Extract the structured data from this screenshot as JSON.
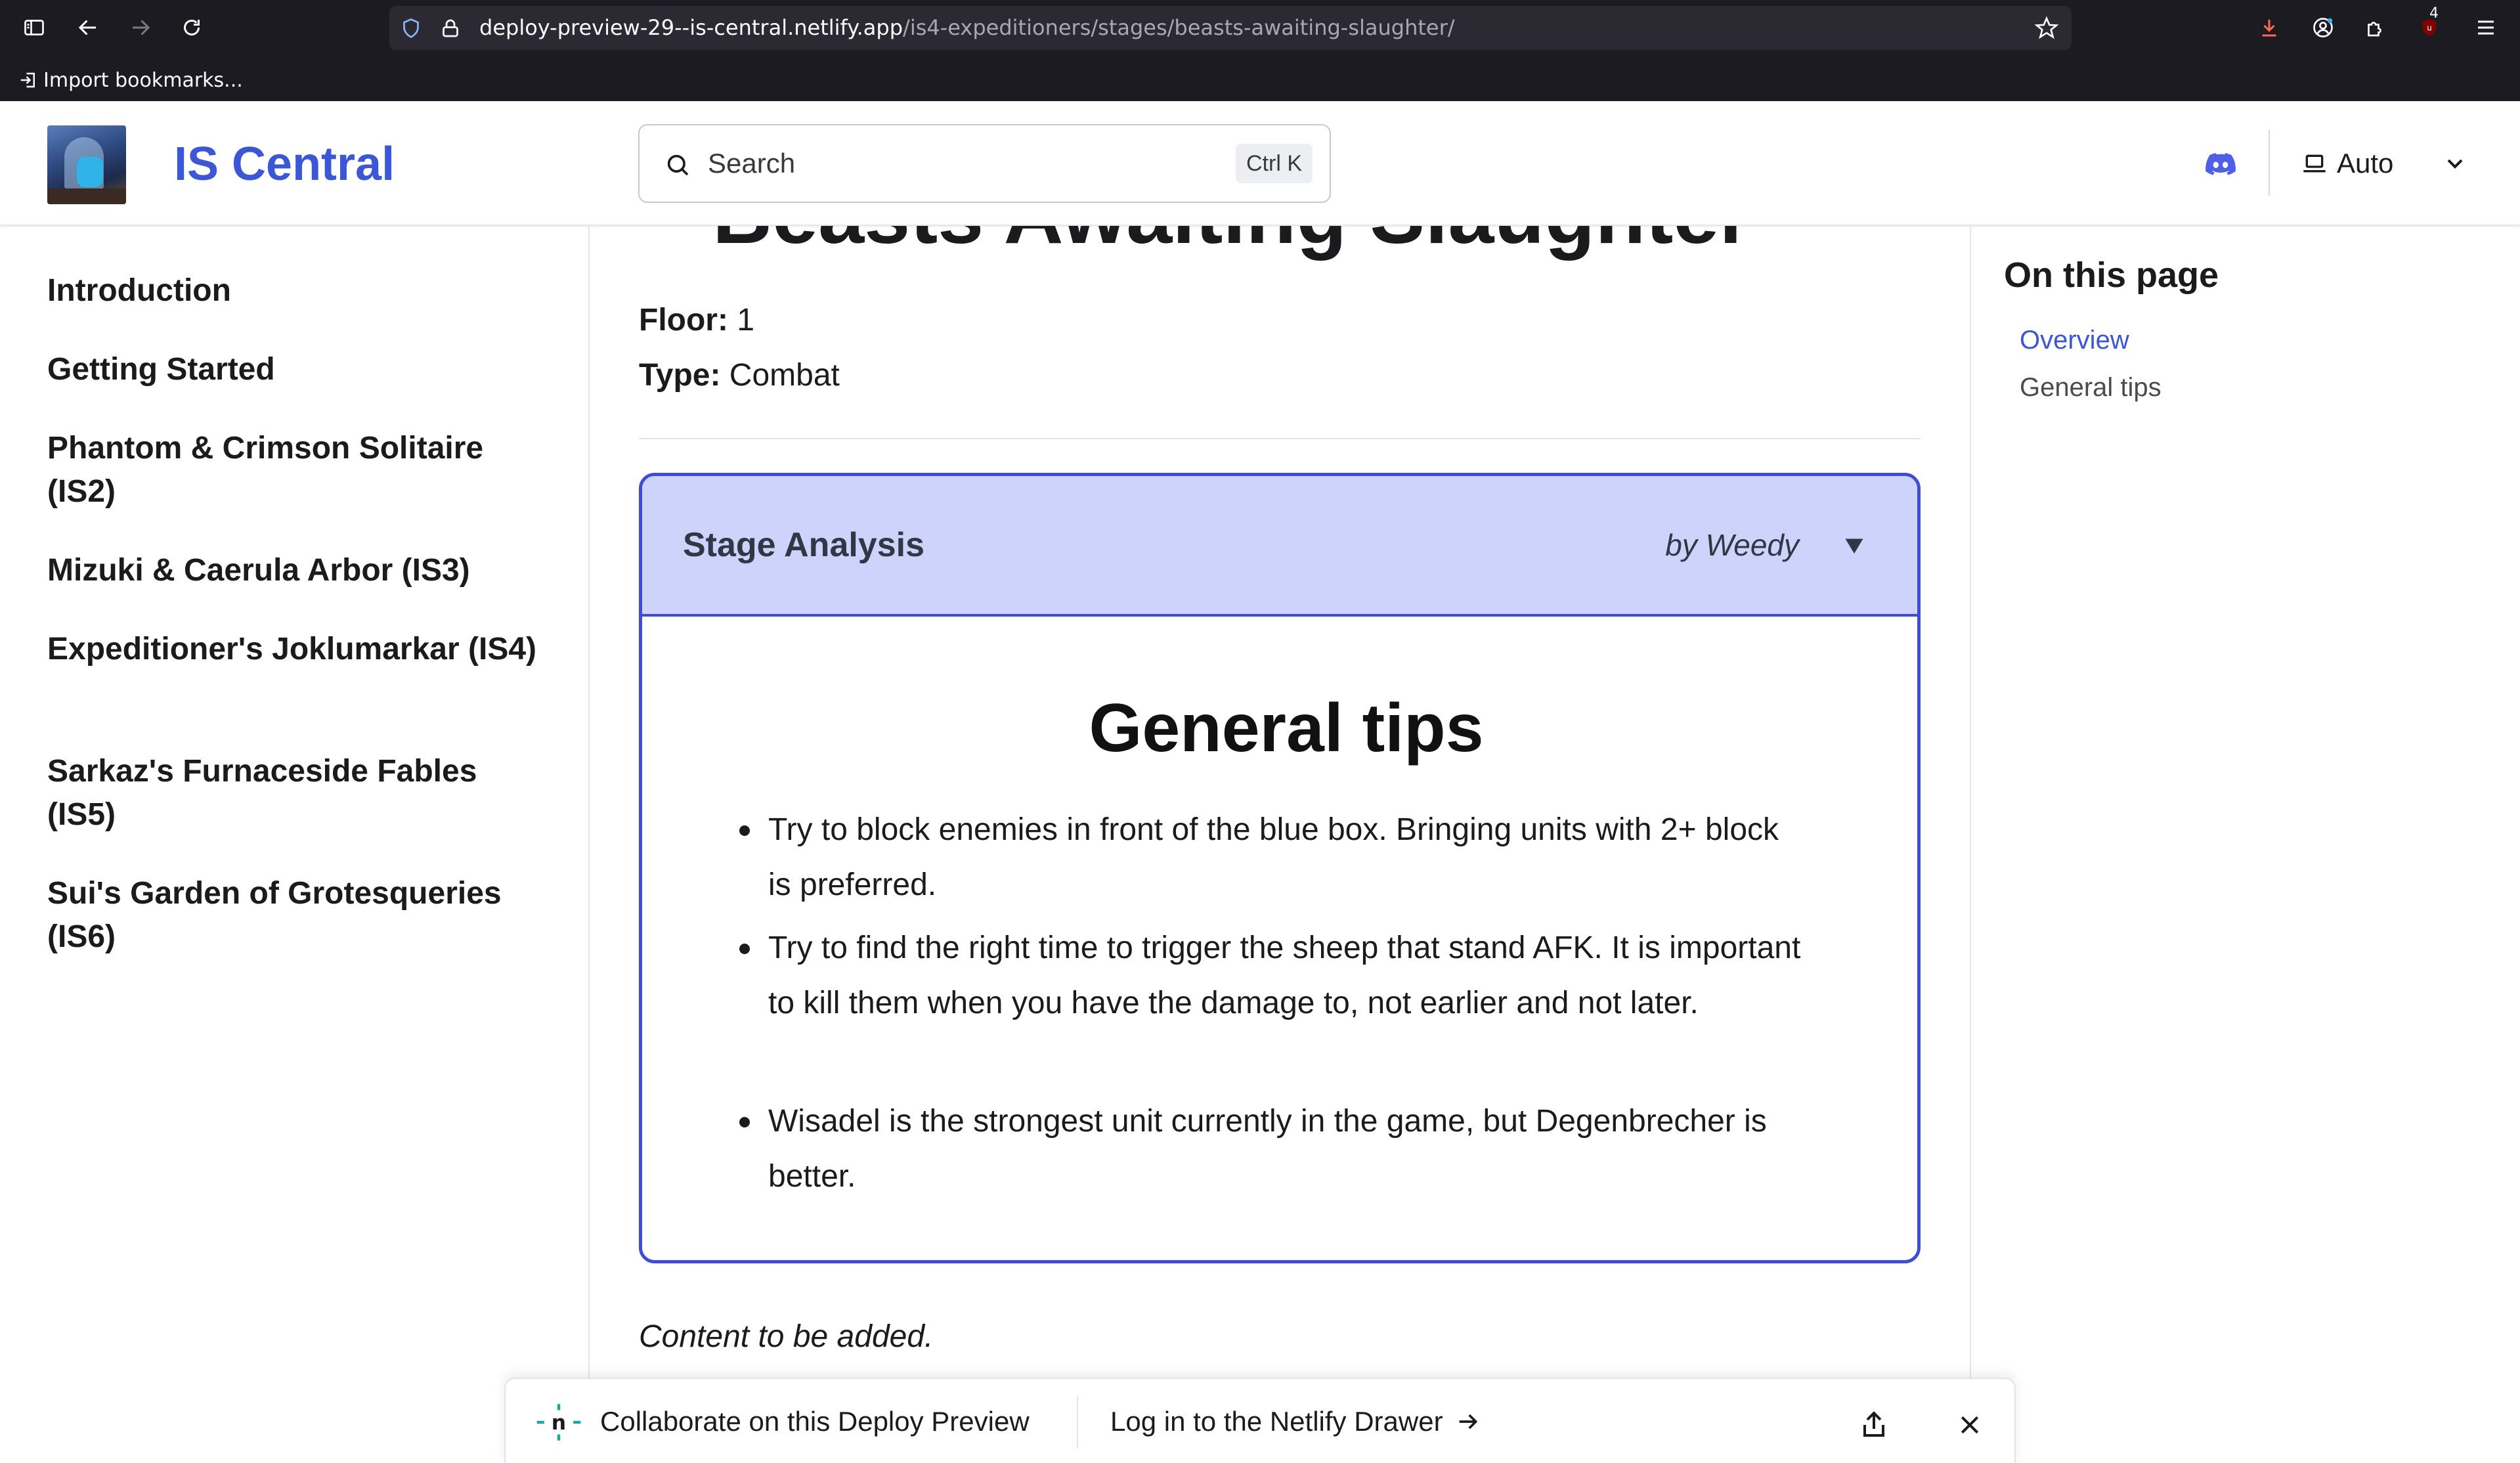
{
  "browser": {
    "url_host": "deploy-preview-29--is-central.netlify.app",
    "url_path": "/is4-expeditioners/stages/beasts-awaiting-slaughter/",
    "bookmark_import": "Import bookmarks...",
    "extension_badge": "4"
  },
  "navbar": {
    "site_title": "IS Central",
    "search_placeholder": "Search",
    "search_shortcut": "Ctrl K",
    "theme_label": "Auto"
  },
  "sidebar": {
    "items": [
      {
        "label": "Introduction"
      },
      {
        "label": "Getting Started"
      },
      {
        "label": "Phantom & Crimson Solitaire (IS2)"
      },
      {
        "label": "Mizuki & Caerula Arbor (IS3)"
      },
      {
        "label": "Expeditioner's Joklumarkar (IS4)"
      },
      {
        "label": "Sarkaz's Furnaceside Fables (IS5)"
      },
      {
        "label": "Sui's Garden of Grotesqueries (IS6)"
      }
    ]
  },
  "main": {
    "page_title": "Beasts Awaiting Slaughter",
    "floor_label": "Floor:",
    "floor_value": "1",
    "type_label": "Type:",
    "type_value": "Combat",
    "analysis": {
      "title": "Stage Analysis",
      "author": "by Weedy",
      "toggle_glyph": "▼",
      "heading": "General tips",
      "tips": [
        "Try to block enemies in front of the blue box. Bringing units with 2+ block is preferred.",
        "Try to find the right time to trigger the sheep that stand AFK. It is important to kill them when you have the damage to, not earlier and not later.",
        "Wisadel is the strongest unit currently in the game, but Degenbrecher is better."
      ]
    },
    "content_placeholder": "Content to be added."
  },
  "toc": {
    "title": "On this page",
    "links": [
      {
        "label": "Overview",
        "active": true
      },
      {
        "label": "General tips",
        "active": false
      }
    ]
  },
  "netlify_drawer": {
    "collab_text": "Collaborate on this Deploy Preview",
    "login_text": "Log in to the Netlify Drawer"
  },
  "colors": {
    "brand": "#3b57d6",
    "analysis_border": "#3f4cd6",
    "analysis_header_bg": "#cdd3fb",
    "toc_active": "#3b57d6",
    "netlify_teal": "#1aa89e"
  }
}
